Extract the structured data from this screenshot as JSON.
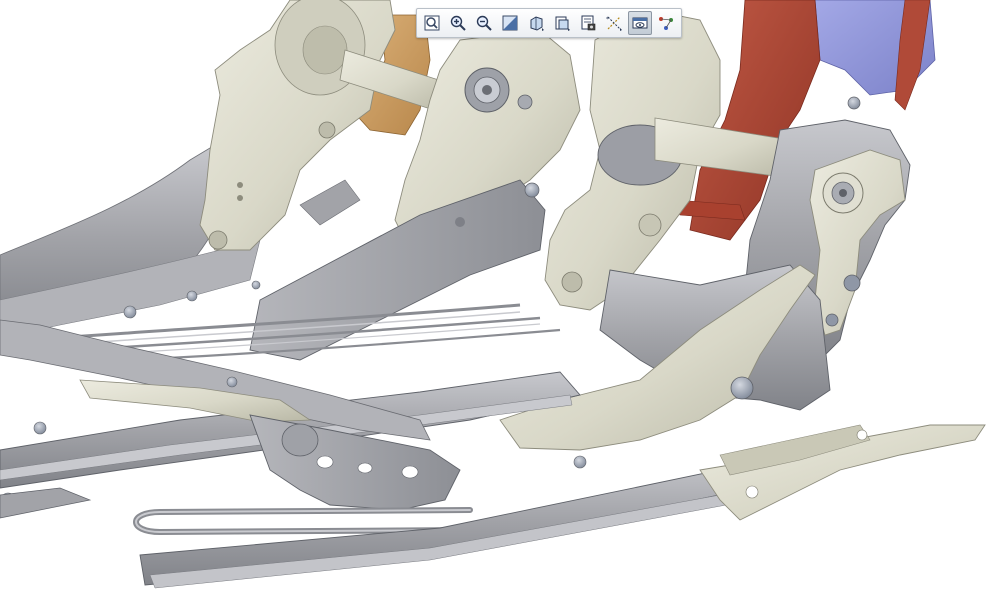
{
  "window": {
    "background": "#ffffff"
  },
  "toolbar": {
    "items": [
      {
        "id": "refit",
        "icon": "refit-icon",
        "tooltip": "Refit",
        "pressed": false
      },
      {
        "id": "zoom-in",
        "icon": "zoom-in-icon",
        "tooltip": "Zoom In",
        "pressed": false
      },
      {
        "id": "zoom-out",
        "icon": "zoom-out-icon",
        "tooltip": "Zoom Out",
        "pressed": false
      },
      {
        "id": "repaint",
        "icon": "repaint-icon",
        "tooltip": "Repaint",
        "pressed": false
      },
      {
        "id": "display-style",
        "icon": "display-style-icon",
        "tooltip": "Display Style",
        "pressed": false
      },
      {
        "id": "saved-orientations",
        "icon": "saved-orientations-icon",
        "tooltip": "Saved Orientations",
        "pressed": false
      },
      {
        "id": "view-manager",
        "icon": "view-manager-icon",
        "tooltip": "View Manager",
        "pressed": false
      },
      {
        "id": "datum-display",
        "icon": "datum-display-icon",
        "tooltip": "Datum Display Filters",
        "pressed": false
      },
      {
        "id": "spin-center",
        "icon": "spin-center-icon",
        "tooltip": "Spin Center",
        "pressed": true
      },
      {
        "id": "annotation-display",
        "icon": "annotation-display-icon",
        "tooltip": "Annotation Display",
        "pressed": false
      }
    ]
  },
  "model": {
    "colors": {
      "cream": "#d9d8c8",
      "cream_dark": "#bdbcaa",
      "cream_light": "#ecebdf",
      "gray": "#a2a3a8",
      "gray_dark": "#7e8087",
      "gray_light": "#c3c4c9",
      "blue_gray": "#8f97a6",
      "red": "#b04a38",
      "red_dark": "#8e3324",
      "orange": "#c99a5b",
      "blue": "#8a8fd8",
      "bolt": "#9aa3b2"
    }
  }
}
